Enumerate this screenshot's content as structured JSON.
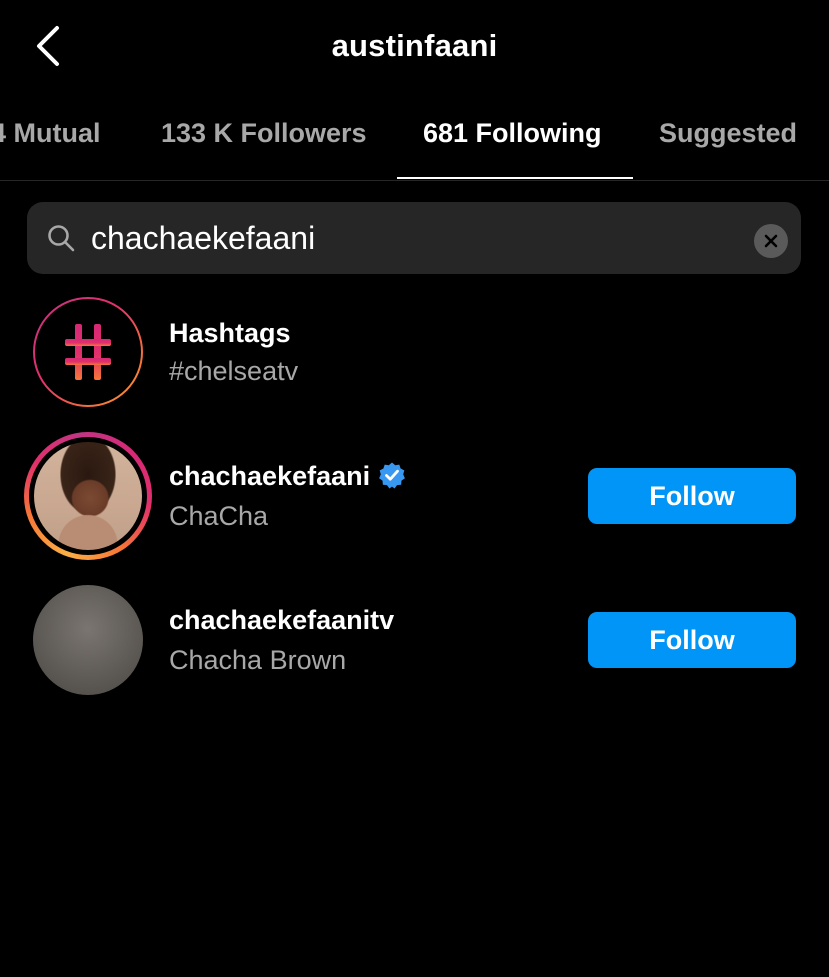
{
  "header": {
    "title": "austinfaani"
  },
  "tabs": [
    {
      "label": "4 Mutual",
      "active": false
    },
    {
      "label": "133 K Followers",
      "active": false
    },
    {
      "label": "681 Following",
      "active": true
    },
    {
      "label": "Suggested",
      "active": false
    }
  ],
  "search": {
    "value": "chachaekefaani",
    "placeholder": "Search"
  },
  "results": [
    {
      "type": "hashtag",
      "title": "Hashtags",
      "subtitle": "#chelseatv"
    },
    {
      "type": "user",
      "username": "chachaekefaani",
      "verified": true,
      "full_name": "ChaCha",
      "button": "Follow",
      "has_story": true
    },
    {
      "type": "user",
      "username": "chachaekefaanitv",
      "verified": false,
      "full_name": "Chacha Brown",
      "button": "Follow",
      "has_story": false
    }
  ],
  "colors": {
    "background": "#000000",
    "accent": "#0095f6",
    "secondary_text": "#a8a8a8",
    "search_bg": "#262626"
  }
}
